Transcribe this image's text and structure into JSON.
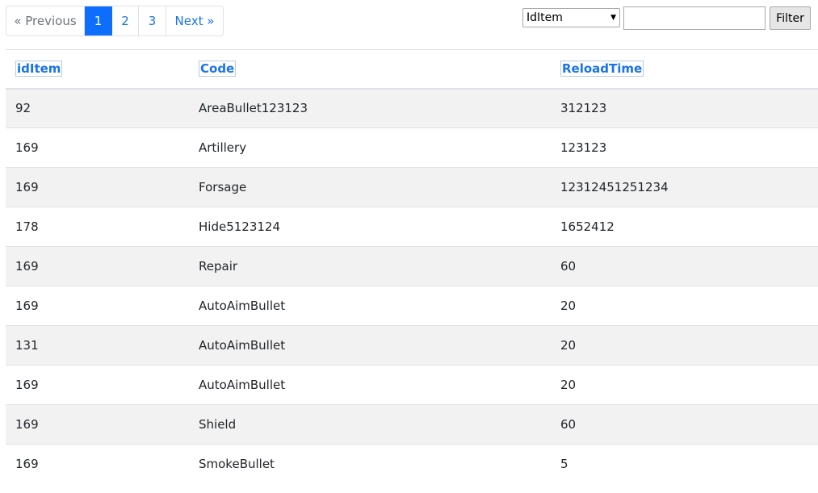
{
  "pagination": {
    "previous_label": "« Previous",
    "pages": [
      "1",
      "2",
      "3"
    ],
    "active_page": "1",
    "next_label": "Next »"
  },
  "filter": {
    "selected_field": "IdItem",
    "input_value": "",
    "button_label": "Filter"
  },
  "table": {
    "columns": [
      "idItem",
      "Code",
      "ReloadTime"
    ],
    "rows": [
      [
        "92",
        "AreaBullet123123",
        "312123"
      ],
      [
        "169",
        "Artillery",
        "123123"
      ],
      [
        "169",
        "Forsage",
        "12312451251234"
      ],
      [
        "178",
        "Hide5123124",
        "1652412"
      ],
      [
        "169",
        "Repair",
        "60"
      ],
      [
        "169",
        "AutoAimBullet",
        "20"
      ],
      [
        "131",
        "AutoAimBullet",
        "20"
      ],
      [
        "169",
        "AutoAimBullet",
        "20"
      ],
      [
        "169",
        "Shield",
        "60"
      ],
      [
        "169",
        "SmokeBullet",
        "5"
      ]
    ]
  },
  "colors": {
    "link": "#1a73e8",
    "active_page_bg": "#0d6efd",
    "stripe_bg": "#f2f2f2"
  }
}
